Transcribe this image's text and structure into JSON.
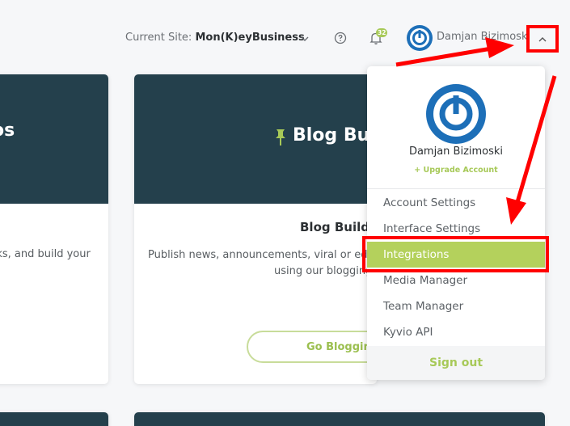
{
  "header": {
    "current_site_label": "Current Site:",
    "current_site_value": "Mon(K)eyBusiness",
    "notification_count": "32",
    "user_name": "Damjan Bizimoski"
  },
  "cards": {
    "left": {
      "title_fragment": "os",
      "description_fragment": "rks, and build your"
    },
    "blog": {
      "title": "Blog Builder",
      "subtitle": "Blog Builder",
      "description_line1": "Publish news, announcements, viral or educational",
      "description_line2": "using our blogging",
      "button_label": "Go Blogging"
    }
  },
  "dropdown": {
    "user_name": "Damjan Bizimoski",
    "upgrade_label": "+ Upgrade Account",
    "items": [
      {
        "label": "Account Settings"
      },
      {
        "label": "Interface Settings"
      },
      {
        "label": "Integrations"
      },
      {
        "label": "Media Manager"
      },
      {
        "label": "Team Manager"
      },
      {
        "label": "Kyvio API"
      }
    ],
    "signout_label": "Sign out"
  },
  "colors": {
    "card_header": "#24404c",
    "accent_green": "#a7c958",
    "active_item": "#b4d15c",
    "annotation_red": "#ff0000"
  }
}
